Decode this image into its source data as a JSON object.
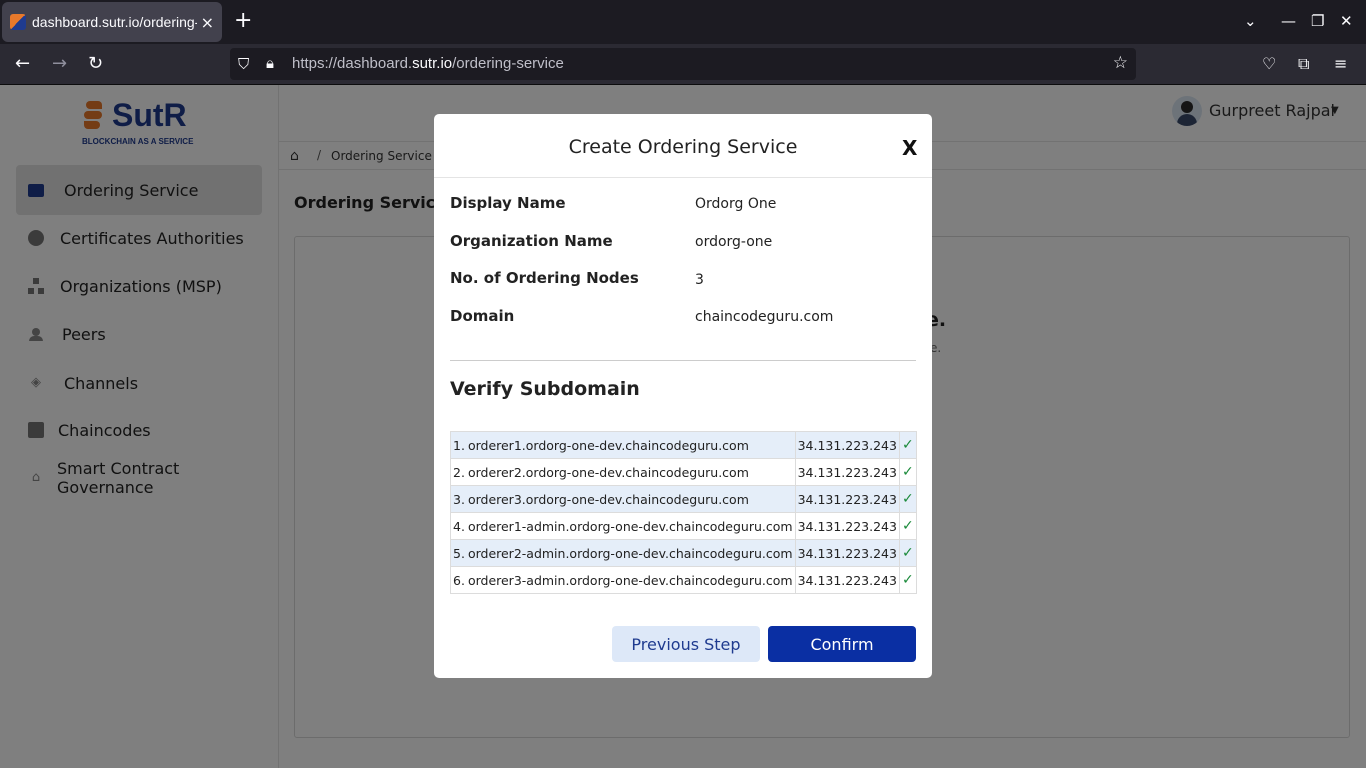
{
  "browser": {
    "tab_title": "dashboard.sutr.io/ordering-service",
    "tab_close": "×",
    "new_tab": "+",
    "url_prefix": "https://dashboard.",
    "url_domain": "sutr.io",
    "url_path": "/ordering-service"
  },
  "sidebar": {
    "brand": "SutR",
    "tagline": "BLOCKCHAIN AS A SERVICE",
    "items": [
      {
        "label": "Ordering Service",
        "active": true,
        "icon": "archive-icon"
      },
      {
        "label": "Certificates Authorities",
        "active": false,
        "icon": "badge-icon"
      },
      {
        "label": "Organizations (MSP)",
        "active": false,
        "icon": "sitemap-icon"
      },
      {
        "label": "Peers",
        "active": false,
        "icon": "users-icon"
      },
      {
        "label": "Channels",
        "active": false,
        "icon": "broadcast-icon"
      },
      {
        "label": "Chaincodes",
        "active": false,
        "icon": "file-code-icon"
      },
      {
        "label": "Smart Contract Governance",
        "active": false,
        "icon": "bank-icon"
      }
    ]
  },
  "header": {
    "user_name": "Gurpreet Rajpal"
  },
  "breadcrumb": {
    "separator": "/",
    "current": "Ordering Service"
  },
  "main": {
    "title": "Ordering Service",
    "empty_title_fragment": "e.",
    "empty_sub_fragment": "e."
  },
  "modal": {
    "title": "Create Ordering Service",
    "close": "X",
    "fields": [
      {
        "label": "Display Name",
        "value": "Ordorg One"
      },
      {
        "label": "Organization Name",
        "value": "ordorg-one"
      },
      {
        "label": "No. of Ordering Nodes",
        "value": "3"
      },
      {
        "label": "Domain",
        "value": "chaincodeguru.com"
      }
    ],
    "section_title": "Verify Subdomain",
    "subdomains": [
      {
        "index": "1.",
        "host": "orderer1.ordorg-one-dev.chaincodeguru.com",
        "ip": "34.131.223.243",
        "verified": "✓"
      },
      {
        "index": "2.",
        "host": "orderer2.ordorg-one-dev.chaincodeguru.com",
        "ip": "34.131.223.243",
        "verified": "✓"
      },
      {
        "index": "3.",
        "host": "orderer3.ordorg-one-dev.chaincodeguru.com",
        "ip": "34.131.223.243",
        "verified": "✓"
      },
      {
        "index": "4.",
        "host": "orderer1-admin.ordorg-one-dev.chaincodeguru.com",
        "ip": "34.131.223.243",
        "verified": "✓"
      },
      {
        "index": "5.",
        "host": "orderer2-admin.ordorg-one-dev.chaincodeguru.com",
        "ip": "34.131.223.243",
        "verified": "✓"
      },
      {
        "index": "6.",
        "host": "orderer3-admin.ordorg-one-dev.chaincodeguru.com",
        "ip": "34.131.223.243",
        "verified": "✓"
      }
    ],
    "prev_label": "Previous Step",
    "confirm_label": "Confirm"
  },
  "colors": {
    "brand_blue": "#1f3b8f",
    "brand_orange": "#e8792b",
    "confirm_bg": "#0a2fa3",
    "row_alt": "#e5eef9",
    "check_green": "#1a8a3a"
  }
}
